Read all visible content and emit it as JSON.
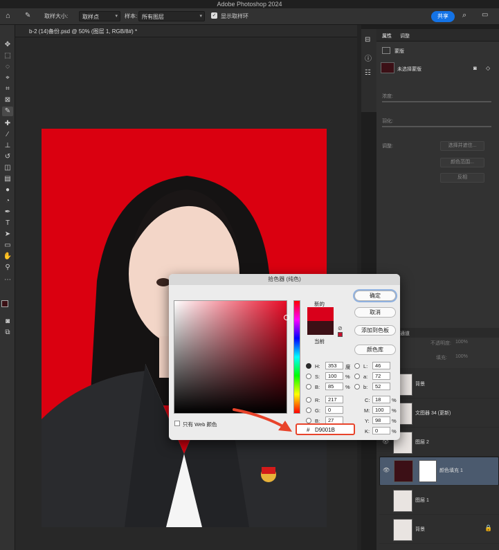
{
  "window": {
    "title": "Adobe Photoshop 2024"
  },
  "options_bar": {
    "sample_size_label": "取样大小:",
    "sample_size_value": "取样点",
    "sample_label": "样本:",
    "sample_value": "所有图层",
    "show_ring_label": "显示取样环",
    "share_label": "共享"
  },
  "document": {
    "tab_title": "b-2 (14)备份.psd @ 50% (图层 1, RGB/8#) *"
  },
  "properties": {
    "tab_properties": "属性",
    "tab_adjust": "调整",
    "mask_label": "蒙版",
    "mask_status": "未选择蒙版",
    "density_label": "浓度:",
    "feather_label": "羽化:",
    "refine_label": "调整:",
    "buttons": [
      "选择并遮住...",
      "颜色范围...",
      "反相"
    ]
  },
  "layers": {
    "tab": "通道",
    "opacity_label": "不透明度:",
    "opacity_value": "100%",
    "fill_label": "填充:",
    "fill_value": "100%",
    "items": [
      {
        "name": "背景",
        "thumb": "photo",
        "selected": false
      },
      {
        "name": "文图器 34 (更新)",
        "thumb": "photo",
        "selected": false
      },
      {
        "name": "图层 2",
        "thumb": "photo",
        "selected": false
      },
      {
        "name": "颜色填充 1",
        "thumb": "fill",
        "selected": true
      },
      {
        "name": "图层 1",
        "thumb": "photo",
        "selected": false
      },
      {
        "name": "背景",
        "thumb": "photo",
        "selected": false
      }
    ]
  },
  "picker": {
    "title": "拾色器 (纯色)",
    "new_label": "新的",
    "current_label": "当前",
    "ok": "确定",
    "cancel": "取消",
    "add_swatch": "添加到色板",
    "libraries": "颜色库",
    "web_only": "只有 Web 颜色",
    "new_color": "#d9001b",
    "current_color": "#3c1016",
    "H": "353",
    "H_unit": "度",
    "S": "100",
    "S_unit": "%",
    "B": "85",
    "B_unit": "%",
    "R": "217",
    "G": "0",
    "Bl": "27",
    "L": "46",
    "a": "72",
    "b": "52",
    "C": "18",
    "C_unit": "%",
    "M": "100",
    "M_unit": "%",
    "Y": "98",
    "Y_unit": "%",
    "K": "0",
    "K_unit": "%",
    "hex": "D9001B",
    "hash": "#"
  },
  "colors": {
    "bg_red": "#da0010",
    "accent": "#1473e6",
    "annotation": "#e8432a"
  }
}
